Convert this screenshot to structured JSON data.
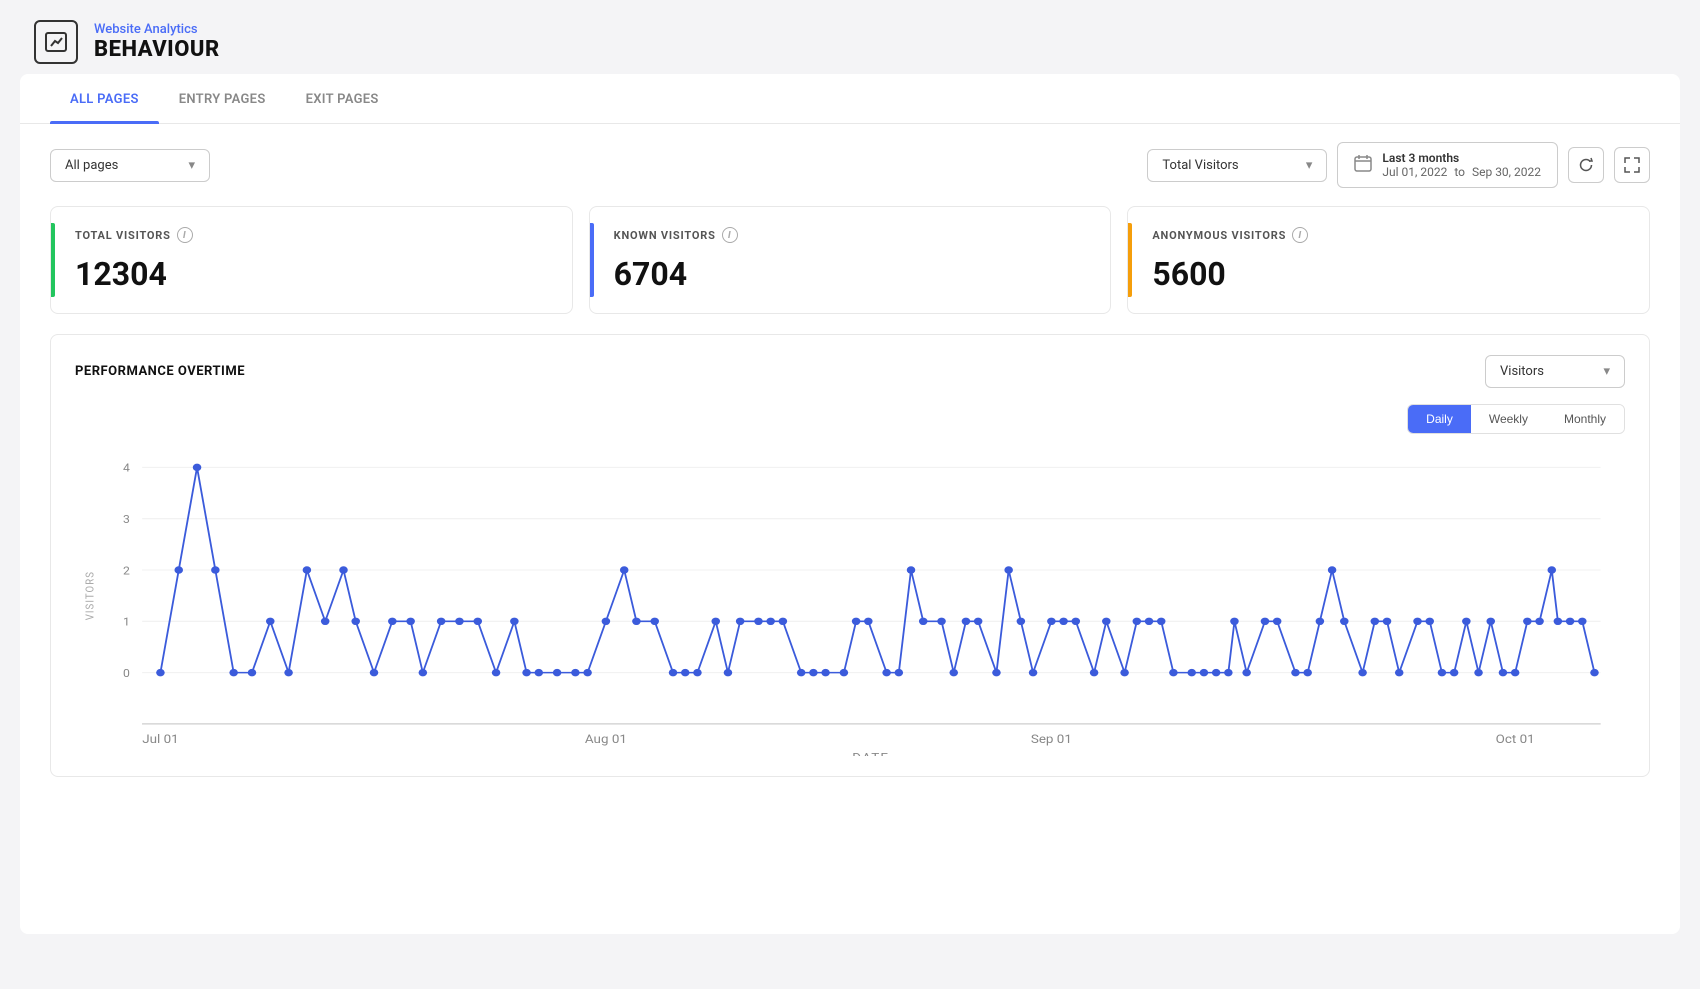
{
  "header": {
    "breadcrumb": "Website Analytics",
    "title": "BEHAVIOUR",
    "icon": "chart-icon"
  },
  "tabs": [
    {
      "id": "all-pages",
      "label": "ALL PAGES",
      "active": true
    },
    {
      "id": "entry-pages",
      "label": "ENTRY PAGES",
      "active": false
    },
    {
      "id": "exit-pages",
      "label": "EXIT PAGES",
      "active": false
    }
  ],
  "controls": {
    "pages_dropdown": "All pages",
    "metric_dropdown": "Total Visitors",
    "date_range_label": "Last 3 months",
    "date_from": "Jul 01, 2022",
    "date_to": "Sep 30, 2022",
    "date_separator": "to"
  },
  "metrics": [
    {
      "id": "total-visitors",
      "label": "TOTAL VISITORS",
      "value": "12304",
      "color": "green"
    },
    {
      "id": "known-visitors",
      "label": "KNOWN VISITORS",
      "value": "6704",
      "color": "blue"
    },
    {
      "id": "anonymous-visitors",
      "label": "ANONYMOUS VISITORS",
      "value": "5600",
      "color": "yellow"
    }
  ],
  "performance": {
    "title": "PERFORMANCE OVERTIME",
    "metric_dropdown": "Visitors",
    "time_buttons": [
      {
        "id": "daily",
        "label": "Daily",
        "active": true
      },
      {
        "id": "weekly",
        "label": "Weekly",
        "active": false
      },
      {
        "id": "monthly",
        "label": "Monthly",
        "active": false
      }
    ],
    "chart": {
      "y_label": "VISITORS",
      "x_label": "DATE",
      "y_ticks": [
        0,
        1,
        2,
        3,
        4
      ],
      "x_ticks": [
        "Jul 01",
        "Aug 01",
        "Sep 01",
        "Oct 01"
      ]
    }
  }
}
